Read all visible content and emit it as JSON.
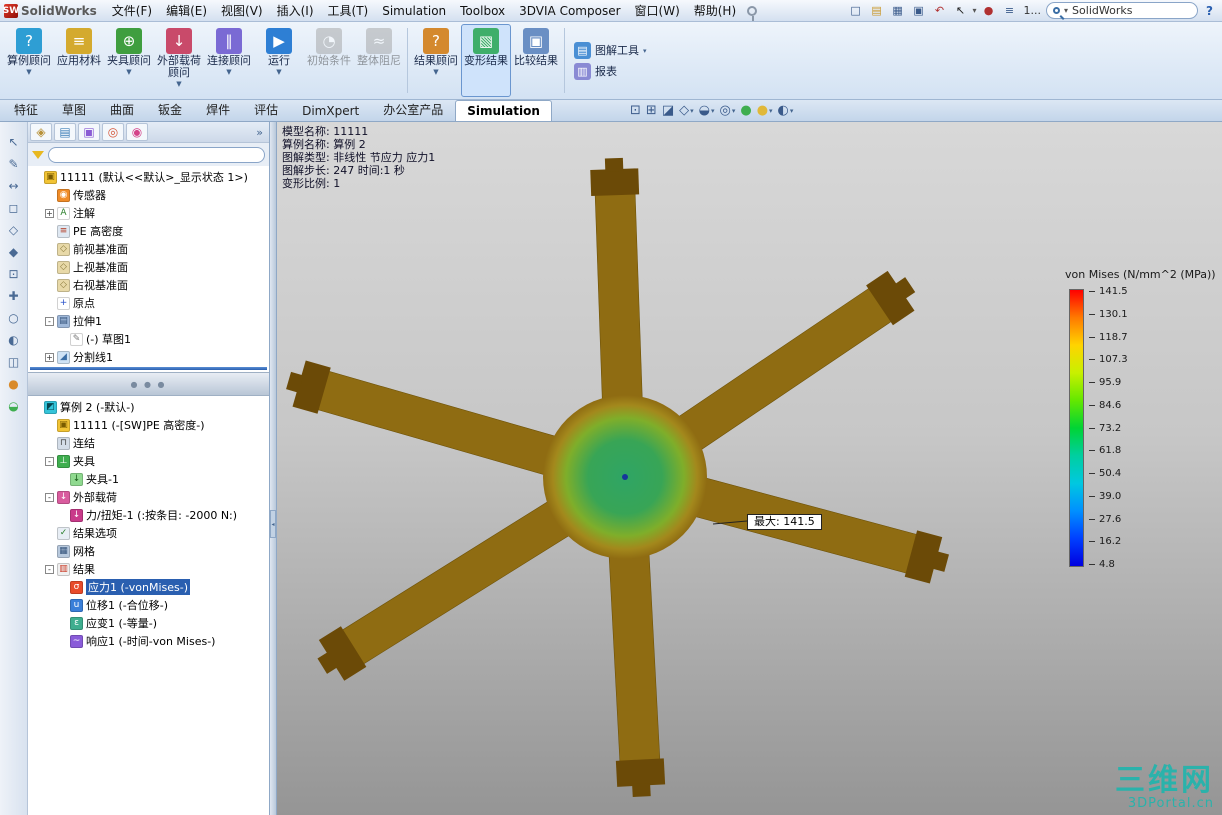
{
  "titlebar": {
    "logo_text": "SolidWorks",
    "menus": [
      "文件(F)",
      "编辑(E)",
      "视图(V)",
      "插入(I)",
      "工具(T)",
      "Simulation",
      "Toolbox",
      "3DVIA Composer",
      "窗口(W)",
      "帮助(H)"
    ],
    "quick_icons": [
      {
        "name": "new-doc-icon"
      },
      {
        "name": "open-icon"
      },
      {
        "name": "save-icon"
      },
      {
        "name": "print-icon"
      },
      {
        "name": "undo-icon"
      },
      {
        "name": "select-arrow-icon",
        "dropdown": true
      },
      {
        "name": "render-sphere-icon"
      },
      {
        "name": "task-pane-icon"
      },
      {
        "name": "toolbar-overflow",
        "label": "1..."
      }
    ],
    "search": {
      "value": "SolidWorks"
    },
    "help_label": "?"
  },
  "commandbar": {
    "buttons": [
      {
        "label": "算例顾问",
        "icon": "study-advisor-icon",
        "dropdown": true
      },
      {
        "label": "应用材料",
        "icon": "apply-material-icon"
      },
      {
        "label": "夹具顾问",
        "icon": "fixtures-advisor-icon",
        "dropdown": true
      },
      {
        "label": "外部载荷顾问",
        "icon": "external-loads-advisor-icon",
        "dropdown": true
      },
      {
        "label": "连接顾问",
        "icon": "connections-advisor-icon",
        "dropdown": true
      },
      {
        "label": "运行",
        "icon": "run-icon",
        "dropdown": true
      },
      {
        "label": "初始条件",
        "icon": "initial-conditions-icon",
        "disabled": true
      },
      {
        "label": "整体阻尼",
        "icon": "global-damping-icon",
        "disabled": true
      },
      {
        "label": "结果顾问",
        "icon": "results-advisor-icon",
        "dropdown": true,
        "sep": true
      },
      {
        "label": "变形结果",
        "icon": "deformed-result-icon",
        "active": true
      },
      {
        "label": "比较结果",
        "icon": "compare-results-icon"
      }
    ],
    "right_buttons": [
      {
        "label": "图解工具",
        "icon": "plot-tools-icon",
        "dropdown": true
      },
      {
        "label": "报表",
        "icon": "report-icon"
      }
    ]
  },
  "tabs": {
    "items": [
      {
        "label": "特征"
      },
      {
        "label": "草图"
      },
      {
        "label": "曲面"
      },
      {
        "label": "钣金"
      },
      {
        "label": "焊件"
      },
      {
        "label": "评估"
      },
      {
        "label": "DimXpert"
      },
      {
        "label": "办公室产品"
      },
      {
        "label": "Simulation",
        "active": true
      }
    ]
  },
  "left_strip": {
    "icons": [
      {
        "name": "select-icon"
      },
      {
        "name": "sketch-icon"
      },
      {
        "name": "dimension-icon"
      },
      {
        "name": "front-view-icon"
      },
      {
        "name": "top-view-icon"
      },
      {
        "name": "isometric-icon"
      },
      {
        "name": "zoom-fit-icon"
      },
      {
        "name": "pan-icon"
      },
      {
        "name": "rotate-view-icon"
      },
      {
        "name": "shaded-view-icon"
      },
      {
        "name": "wireframe-icon"
      },
      {
        "name": "appearance-icon"
      },
      {
        "name": "scene-icon"
      }
    ]
  },
  "panel": {
    "tab_icons": [
      {
        "name": "feature-manager-icon"
      },
      {
        "name": "property-manager-icon"
      },
      {
        "name": "configuration-manager-icon"
      },
      {
        "name": "dimxpert-manager-icon"
      },
      {
        "name": "display-manager-icon"
      }
    ],
    "overflow_label": "»",
    "filter": {
      "value": "",
      "placeholder": ""
    },
    "feature_tree": [
      {
        "label": "11111  (默认<<默认>_显示状态 1>)",
        "icon": "part-icon",
        "indent": 0,
        "expander": ""
      },
      {
        "label": "传感器",
        "icon": "sensor-icon",
        "indent": 1,
        "expander": ""
      },
      {
        "label": "注解",
        "icon": "annotations-icon",
        "indent": 1,
        "expander": "+"
      },
      {
        "label": "PE 高密度",
        "icon": "material-icon",
        "indent": 1,
        "expander": ""
      },
      {
        "label": "前视基准面",
        "icon": "plane-icon",
        "indent": 1,
        "expander": ""
      },
      {
        "label": "上视基准面",
        "icon": "plane-icon",
        "indent": 1,
        "expander": ""
      },
      {
        "label": "右视基准面",
        "icon": "plane-icon",
        "indent": 1,
        "expander": ""
      },
      {
        "label": "原点",
        "icon": "origin-icon",
        "indent": 1,
        "expander": ""
      },
      {
        "label": "拉伸1",
        "icon": "extrude-icon",
        "indent": 1,
        "expander": "-"
      },
      {
        "label": "(-) 草图1",
        "icon": "sketch-icon",
        "indent": 2,
        "expander": ""
      },
      {
        "label": "分割线1",
        "icon": "split-line-icon",
        "indent": 1,
        "expander": "+"
      }
    ],
    "sim_tree": [
      {
        "label": "算例 2 (-默认-)",
        "icon": "study-icon",
        "indent": 0,
        "expander": ""
      },
      {
        "label": "11111 (-[SW]PE 高密度-)",
        "icon": "part-icon",
        "indent": 1,
        "expander": ""
      },
      {
        "label": "连结",
        "icon": "connections-icon",
        "indent": 1,
        "expander": ""
      },
      {
        "label": "夹具",
        "icon": "fixtures-icon",
        "indent": 1,
        "expander": "-"
      },
      {
        "label": "夹具-1",
        "icon": "fixture-icon",
        "indent": 2,
        "expander": ""
      },
      {
        "label": "外部载荷",
        "icon": "external-loads-icon",
        "indent": 1,
        "expander": "-"
      },
      {
        "label": "力/扭矩-1 (:按条目: -2000 N:)",
        "icon": "force-icon",
        "indent": 2,
        "expander": ""
      },
      {
        "label": "结果选项",
        "icon": "result-options-icon",
        "indent": 1,
        "expander": ""
      },
      {
        "label": "网格",
        "icon": "mesh-icon",
        "indent": 1,
        "expander": ""
      },
      {
        "label": "结果",
        "icon": "results-icon",
        "indent": 1,
        "expander": "-"
      },
      {
        "label": "应力1 (-vonMises-)",
        "icon": "stress-plot-icon",
        "indent": 2,
        "expander": "",
        "selected": true
      },
      {
        "label": "位移1 (-合位移-)",
        "icon": "displacement-plot-icon",
        "indent": 2,
        "expander": ""
      },
      {
        "label": "应变1 (-等量-)",
        "icon": "strain-plot-icon",
        "indent": 2,
        "expander": ""
      },
      {
        "label": "响应1 (-时间-von Mises-)",
        "icon": "response-plot-icon",
        "indent": 2,
        "expander": ""
      }
    ]
  },
  "viewport": {
    "headsup": [
      {
        "name": "zoom-fit-icon"
      },
      {
        "name": "zoom-area-icon"
      },
      {
        "name": "section-view-icon"
      },
      {
        "name": "view-orientation-icon",
        "dropdown": true
      },
      {
        "name": "display-style-icon",
        "dropdown": true
      },
      {
        "name": "hide-show-items-icon",
        "dropdown": true
      },
      {
        "name": "edit-appearance-icon"
      },
      {
        "name": "apply-scene-icon",
        "dropdown": true
      },
      {
        "name": "view-settings-icon",
        "dropdown": true
      }
    ],
    "annotations": {
      "lines": [
        "模型名称: 11111",
        "算例名称: 算例 2",
        "图解类型: 非线性 节应力 应力1",
        "图解步长: 247   时间:1 秒",
        "变形比例: 1"
      ]
    },
    "callout": {
      "text": "最大:  141.5"
    },
    "legend": {
      "title": "von Mises (N/mm^2 (MPa))",
      "values": [
        "141.5",
        "130.1",
        "118.7",
        "107.3",
        "95.9",
        "84.6",
        "73.2",
        "61.8",
        "50.4",
        "39.0",
        "27.6",
        "16.2",
        "4.8"
      ],
      "colors": [
        "#ff0000",
        "#ff7a00",
        "#ffd400",
        "#c8f000",
        "#64e800",
        "#00d435",
        "#00cfa0",
        "#00c8e0",
        "#0090ff",
        "#0040ff",
        "#0000e0"
      ]
    },
    "model": {
      "center_color": "#38a556",
      "arm_color": "#8f6c12",
      "tip_color": "#6b4a07",
      "dot_color": "#16379b",
      "arms": [
        {
          "angle": -92,
          "length": 312
        },
        {
          "angle": -34,
          "length": 337
        },
        {
          "angle": 15,
          "length": 326
        },
        {
          "angle": 87,
          "length": 313
        },
        {
          "angle": 148,
          "length": 350
        },
        {
          "angle": 196,
          "length": 343
        }
      ]
    },
    "watermark": {
      "line1": "三维网",
      "line2": "3DPortal.cn",
      "color": "#1fb5ad"
    }
  }
}
